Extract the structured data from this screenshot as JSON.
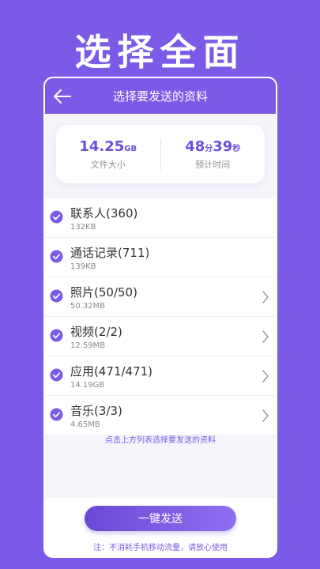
{
  "headline": "选择全面",
  "screen": {
    "title": "选择要发送的资料",
    "summary": {
      "file_size_value": "14.25",
      "file_size_unit": "GB",
      "file_size_label": "文件大小",
      "time_minutes": "48",
      "time_min_unit": "分",
      "time_seconds": "39",
      "time_sec_unit": "秒",
      "time_label": "预计时间"
    },
    "items": [
      {
        "title": "联系人(360)",
        "size": "132KB",
        "has_arrow": false
      },
      {
        "title": "通话记录(711)",
        "size": "139KB",
        "has_arrow": false
      },
      {
        "title": "照片(50/50)",
        "size": "50.32MB",
        "has_arrow": true
      },
      {
        "title": "视频(2/2)",
        "size": "12.59MB",
        "has_arrow": true
      },
      {
        "title": "应用(471/471)",
        "size": "14.19GB",
        "has_arrow": true
      },
      {
        "title": "音乐(3/3)",
        "size": "4.65MB",
        "has_arrow": true
      }
    ],
    "hint": "点击上方列表选择要发送的资料",
    "send_label": "一键发送",
    "note": "注：不消耗手机移动流量，请放心使用"
  },
  "colors": {
    "brand": "#7a5ae6",
    "accent": "#6c4fe0"
  },
  "icons": {
    "back": "arrow-left-icon",
    "check": "check-circle-icon",
    "chevron": "chevron-right-icon"
  }
}
